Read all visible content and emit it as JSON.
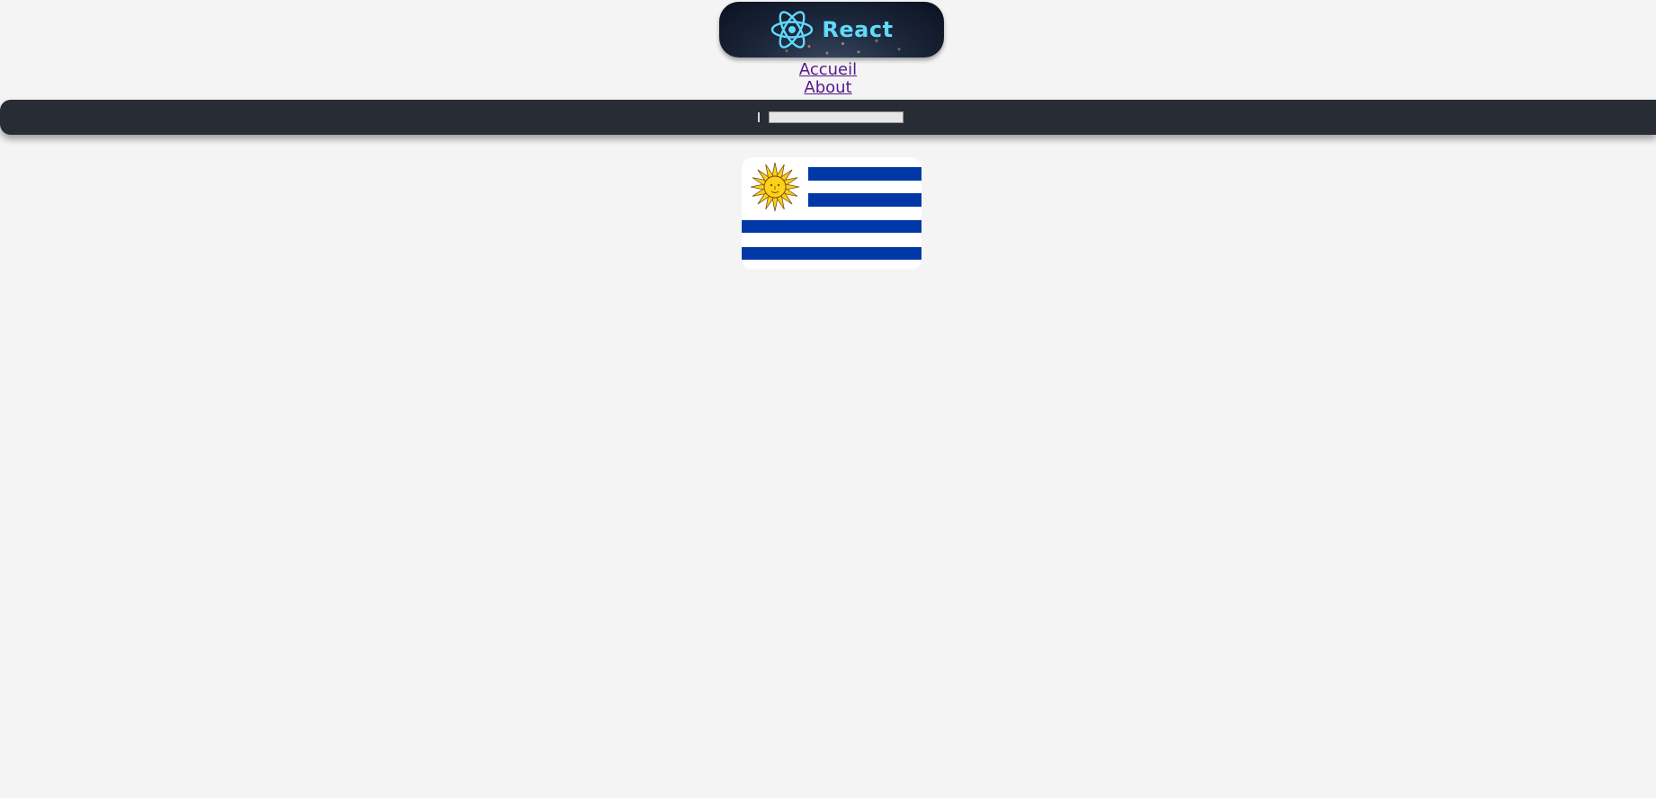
{
  "header": {
    "brand": "React",
    "logo_icon": "react-atom-icon",
    "colors": {
      "brand": "#61dafb",
      "toolbar_bg": "#282c34"
    }
  },
  "nav": {
    "links": [
      {
        "label": "Accueil"
      },
      {
        "label": "About"
      }
    ]
  },
  "toolbar": {
    "search": {
      "value": "",
      "placeholder": ""
    }
  },
  "flag_card": {
    "image": "uruguay-flag",
    "colors": {
      "blue": "#0038a8",
      "white": "#ffffff",
      "sun": "#fcd116"
    }
  }
}
